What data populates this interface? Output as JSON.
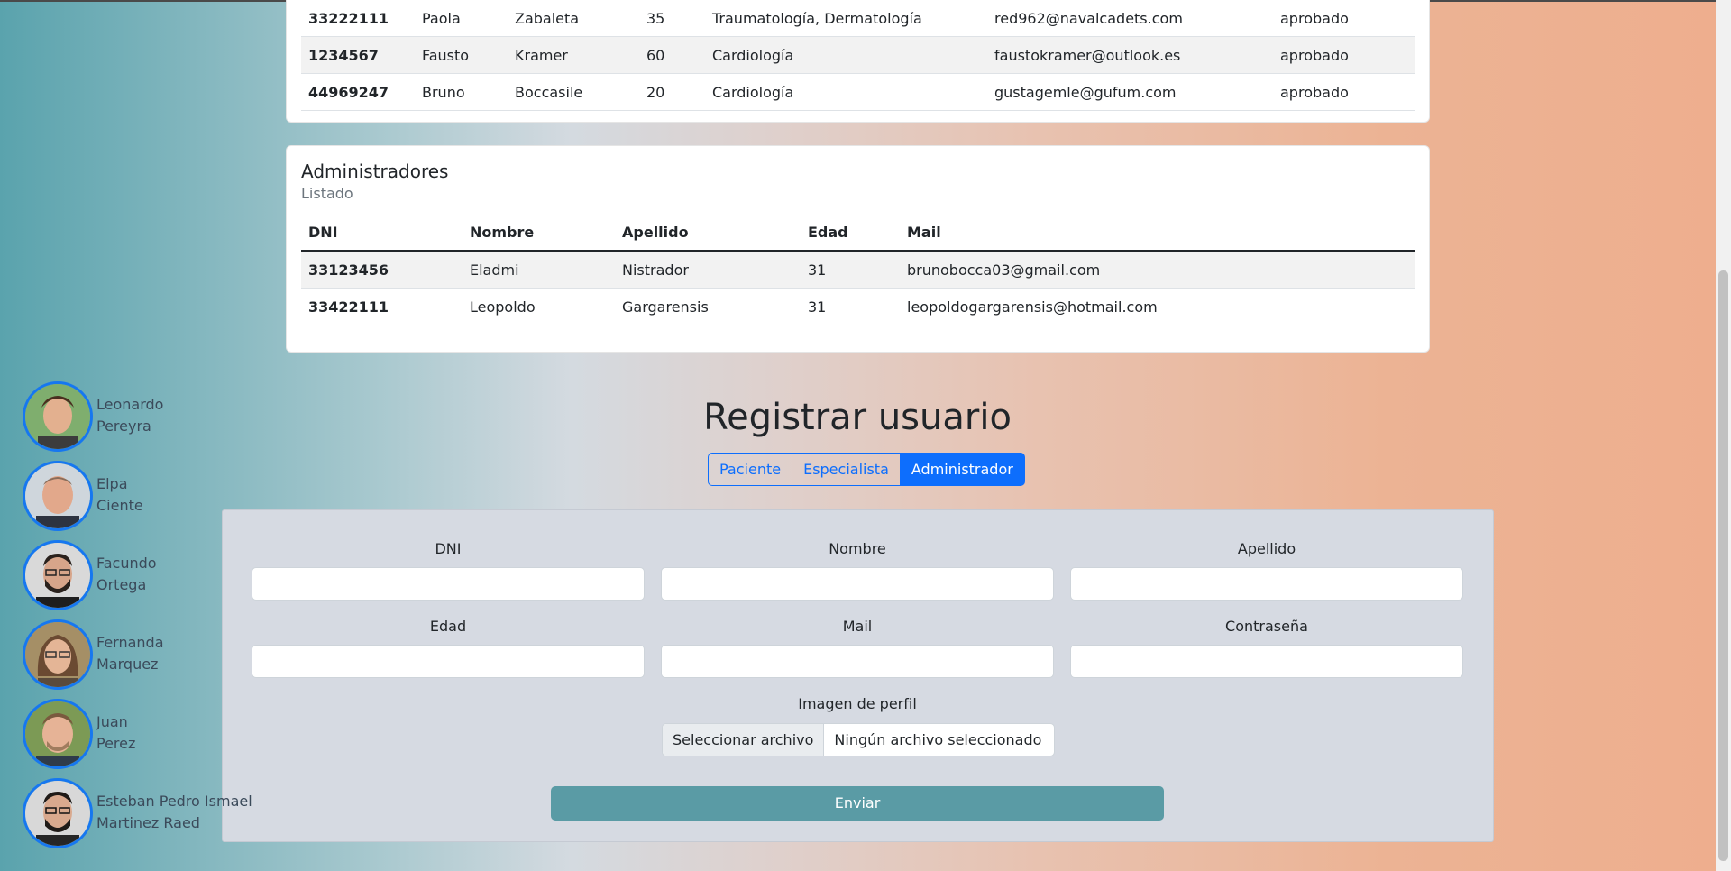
{
  "especialistas": {
    "rows": [
      {
        "dni": "33222111",
        "nombre": "Paola",
        "apellido": "Zabaleta",
        "edad": "35",
        "especialidades": "Traumatología, Dermatología",
        "mail": "red962@navalcadets.com",
        "estado": "aprobado"
      },
      {
        "dni": "1234567",
        "nombre": "Fausto",
        "apellido": "Kramer",
        "edad": "60",
        "especialidades": "Cardiología",
        "mail": "faustokramer@outlook.es",
        "estado": "aprobado"
      },
      {
        "dni": "44969247",
        "nombre": "Bruno",
        "apellido": "Boccasile",
        "edad": "20",
        "especialidades": "Cardiología",
        "mail": "gustagemle@gufum.com",
        "estado": "aprobado"
      }
    ]
  },
  "administradores": {
    "title": "Administradores",
    "subtitle": "Listado",
    "headers": {
      "dni": "DNI",
      "nombre": "Nombre",
      "apellido": "Apellido",
      "edad": "Edad",
      "mail": "Mail"
    },
    "rows": [
      {
        "dni": "33123456",
        "nombre": "Eladmi",
        "apellido": "Nistrador",
        "edad": "31",
        "mail": "brunobocca03@gmail.com"
      },
      {
        "dni": "33422111",
        "nombre": "Leopoldo",
        "apellido": "Gargarensis",
        "edad": "31",
        "mail": "leopoldogargarensis@hotmail.com"
      }
    ]
  },
  "registro": {
    "title": "Registrar usuario",
    "tabs": [
      "Paciente",
      "Especialista",
      "Administrador"
    ],
    "active_tab": "Administrador",
    "labels": {
      "dni": "DNI",
      "nombre": "Nombre",
      "apellido": "Apellido",
      "edad": "Edad",
      "mail": "Mail",
      "contrasena": "Contraseña",
      "imagen": "Imagen de perfil"
    },
    "file_button": "Seleccionar archivo",
    "file_status": "Ningún archivo seleccionado",
    "submit": "Enviar"
  },
  "sidebar": {
    "users": [
      {
        "first": "Leonardo",
        "last": "Pereyra"
      },
      {
        "first": "Elpa",
        "last": "Ciente"
      },
      {
        "first": "Facundo",
        "last": "Ortega"
      },
      {
        "first": "Fernanda",
        "last": "Marquez"
      },
      {
        "first": "Juan",
        "last": "Perez"
      },
      {
        "first": "Esteban Pedro Ismael",
        "last": "Martinez Raed"
      }
    ]
  },
  "colors": {
    "primary": "#0d6efd",
    "submit": "#5a9ba5",
    "avatar_ring": "#1677f0"
  }
}
